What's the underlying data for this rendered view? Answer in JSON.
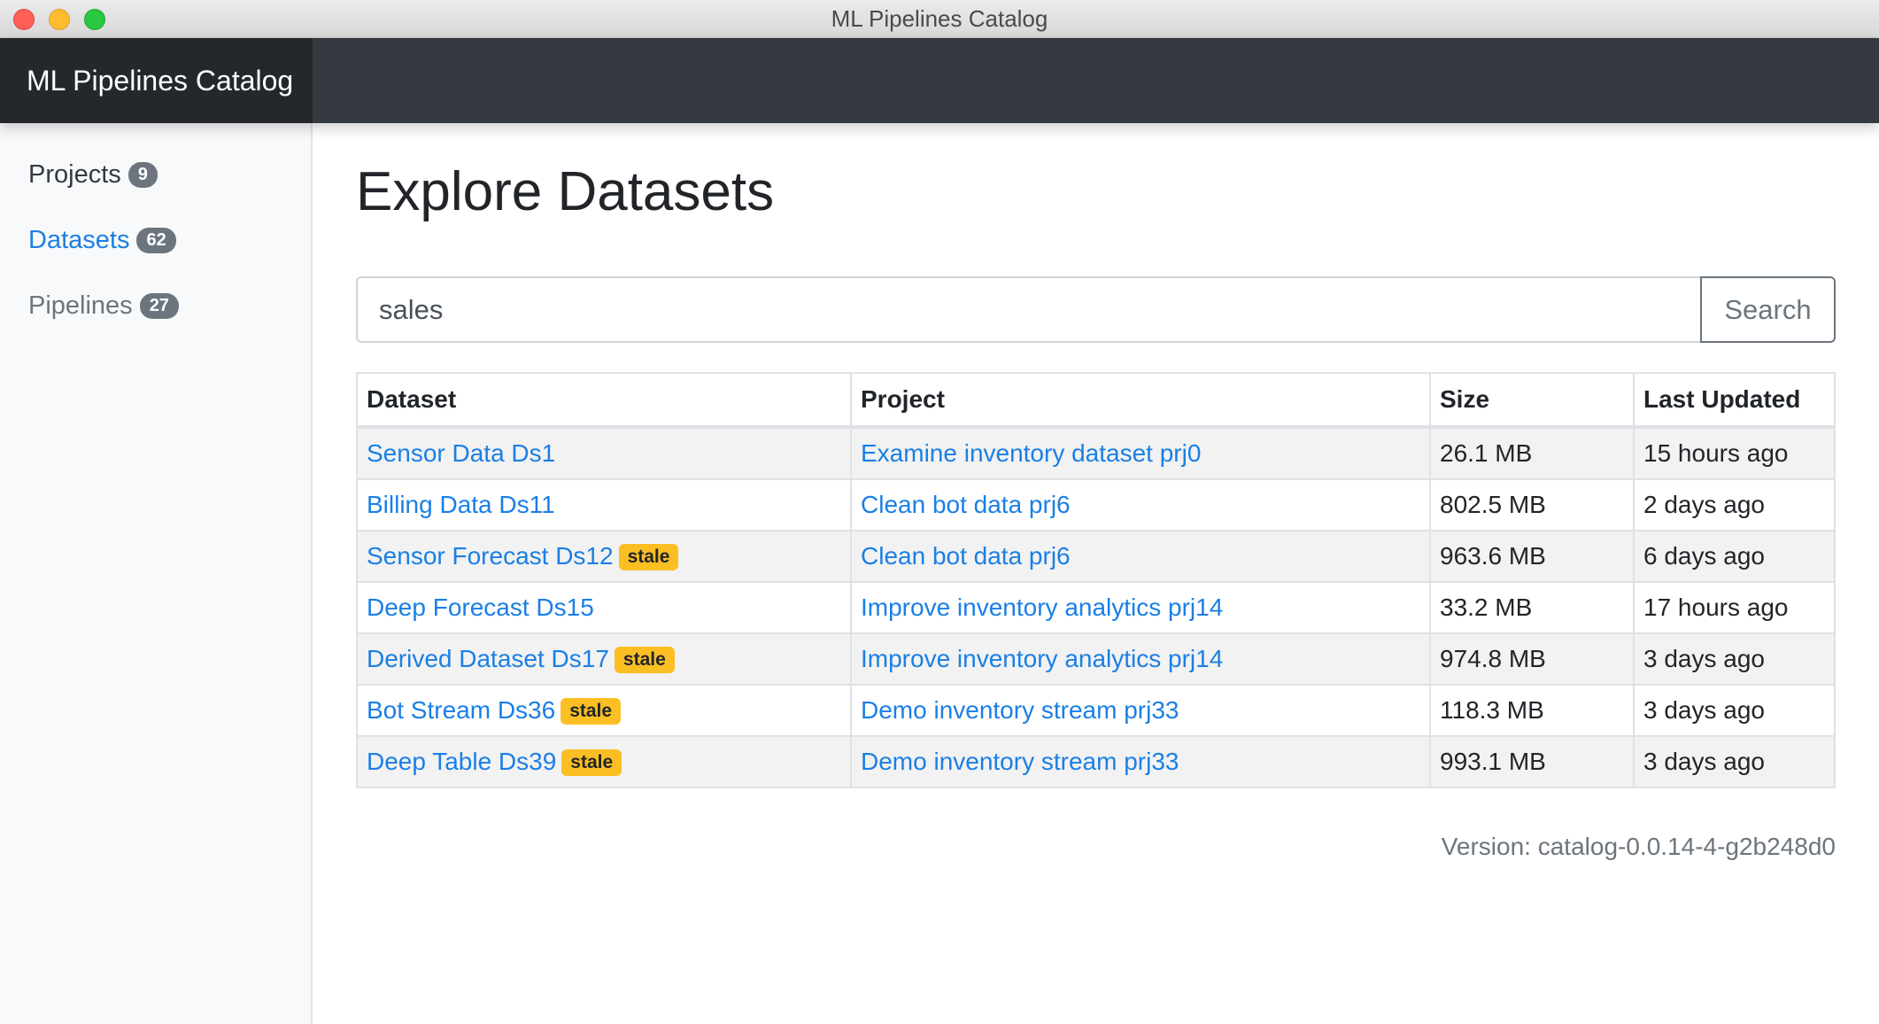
{
  "window": {
    "title": "ML Pipelines Catalog"
  },
  "header": {
    "brand": "ML Pipelines Catalog"
  },
  "sidebar": {
    "items": [
      {
        "label": "Projects",
        "count": "9",
        "state": "default"
      },
      {
        "label": "Datasets",
        "count": "62",
        "state": "active"
      },
      {
        "label": "Pipelines",
        "count": "27",
        "state": "muted"
      }
    ]
  },
  "main": {
    "title": "Explore Datasets",
    "search": {
      "value": "sales",
      "button_label": "Search"
    },
    "table": {
      "columns": [
        "Dataset",
        "Project",
        "Size",
        "Last Updated"
      ],
      "rows": [
        {
          "dataset": "Sensor Data Ds1",
          "badge": "",
          "project": "Examine inventory dataset prj0",
          "size": "26.1 MB",
          "updated": "15 hours ago"
        },
        {
          "dataset": "Billing Data Ds11",
          "badge": "",
          "project": "Clean bot data prj6",
          "size": "802.5 MB",
          "updated": "2 days ago"
        },
        {
          "dataset": "Sensor Forecast Ds12",
          "badge": "stale",
          "project": "Clean bot data prj6",
          "size": "963.6 MB",
          "updated": "6 days ago"
        },
        {
          "dataset": "Deep Forecast Ds15",
          "badge": "",
          "project": "Improve inventory analytics prj14",
          "size": "33.2 MB",
          "updated": "17 hours ago"
        },
        {
          "dataset": "Derived Dataset Ds17",
          "badge": "stale",
          "project": "Improve inventory analytics prj14",
          "size": "974.8 MB",
          "updated": "3 days ago"
        },
        {
          "dataset": "Bot Stream Ds36",
          "badge": "stale",
          "project": "Demo inventory stream prj33",
          "size": "118.3 MB",
          "updated": "3 days ago"
        },
        {
          "dataset": "Deep Table Ds39",
          "badge": "stale",
          "project": "Demo inventory stream prj33",
          "size": "993.1 MB",
          "updated": "3 days ago"
        }
      ]
    },
    "version": "Version: catalog-0.0.14-4-g2b248d0"
  },
  "colors": {
    "link": "#1a7fe5",
    "navbar": "#343a40",
    "brand_bg": "#24282c",
    "badge": "#6c757d",
    "stale_badge": "#fbbf24"
  }
}
